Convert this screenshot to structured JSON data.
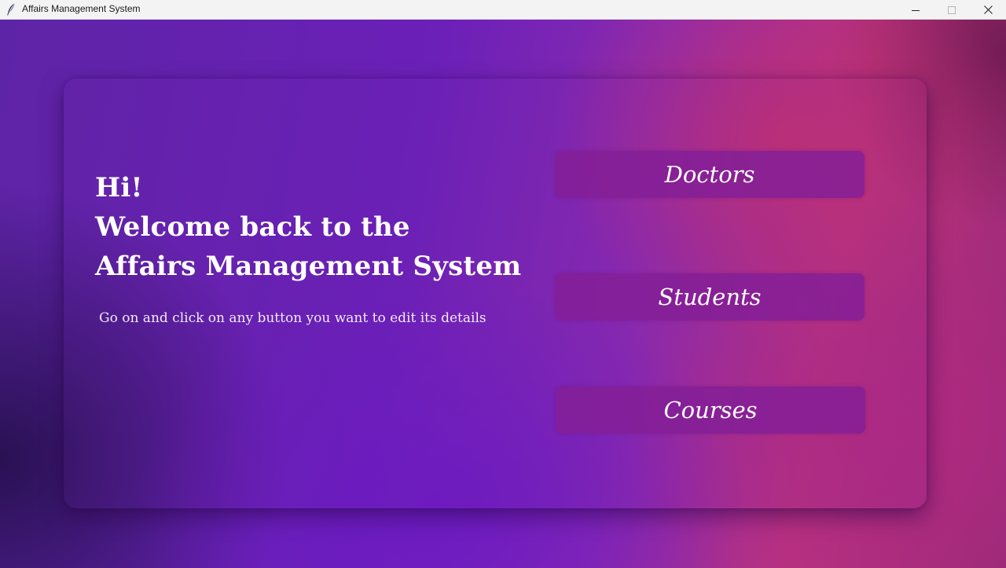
{
  "window": {
    "title": "Affairs Management System",
    "app_icon": "feather-icon",
    "controls": [
      "minimize-icon",
      "maximize-icon",
      "close-icon"
    ]
  },
  "welcome": {
    "line1": "Hi!",
    "line2": "Welcome back to the",
    "line3": "Affairs Management System",
    "subtitle": "Go on and click on any button you want to edit its details"
  },
  "buttons": {
    "doctors": "Doctors",
    "students": "Students",
    "courses": "Courses"
  },
  "colors": {
    "button_bg": "#841e96",
    "text": "#ffffff",
    "gradient_purple": "#6b20b8",
    "gradient_pink": "#b83280"
  }
}
